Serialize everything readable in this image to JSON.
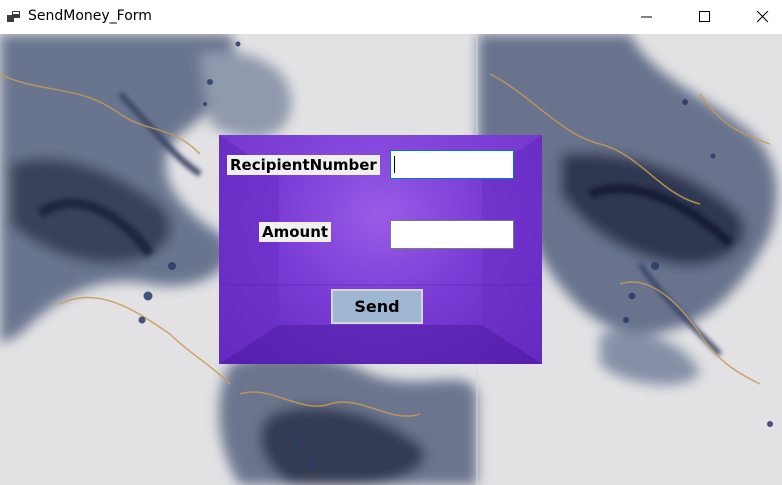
{
  "window": {
    "title": "SendMoney_Form",
    "icon": "app-window-icon",
    "controls": [
      "minimize-icon",
      "maximize-icon",
      "close-icon"
    ]
  },
  "form": {
    "recipient_label": "RecipientNumber",
    "recipient_value": "",
    "amount_label": "Amount",
    "amount_value": "",
    "send_label": "Send"
  },
  "colors": {
    "panel": "#7a3cd6",
    "button": "#9fb6d3",
    "focus_border": "#0078d7"
  }
}
